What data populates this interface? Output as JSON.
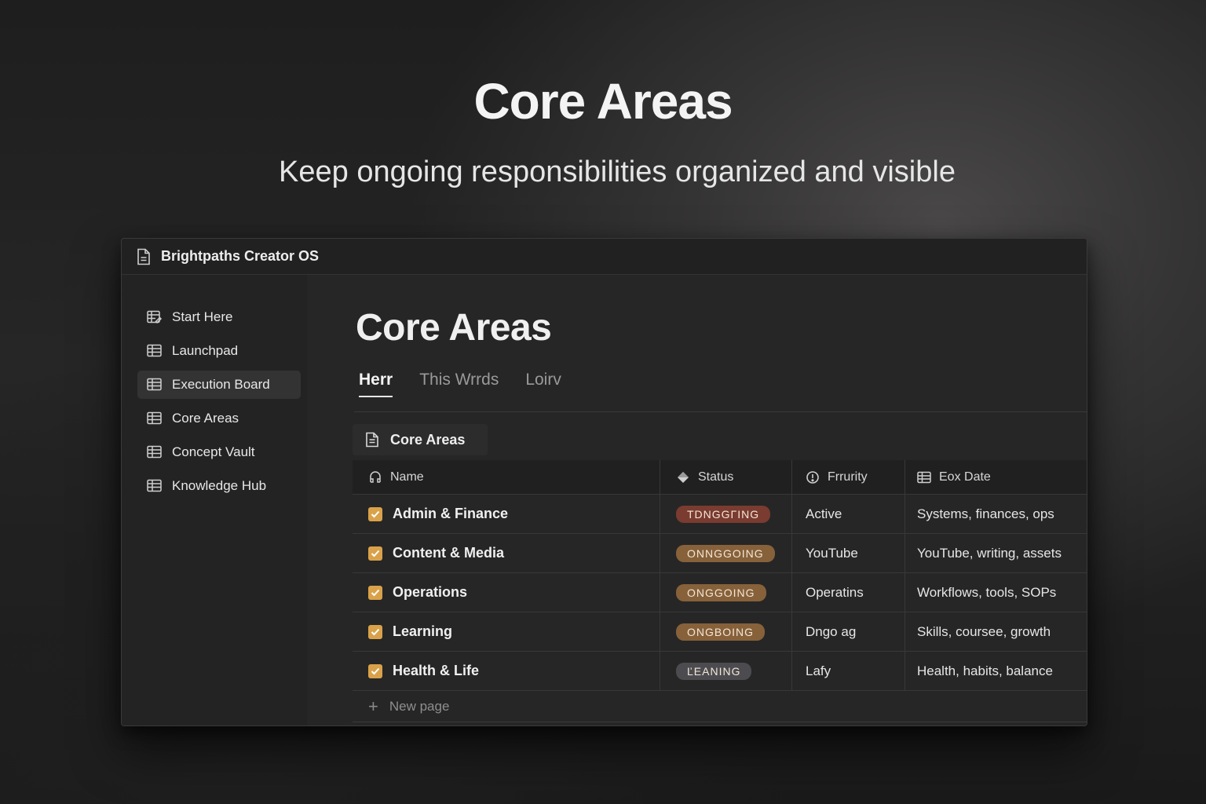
{
  "hero": {
    "title": "Core Areas",
    "subtitle": "Keep ongoing responsibilities organized and visible"
  },
  "window": {
    "title": "Brightpaths Creator OS",
    "title_icon": "document-icon"
  },
  "sidebar": {
    "items": [
      {
        "label": "Start Here",
        "icon": "table-edit-icon",
        "active": false
      },
      {
        "label": "Launchpad",
        "icon": "table-icon",
        "active": false
      },
      {
        "label": "Execution Board",
        "icon": "table-icon",
        "active": true
      },
      {
        "label": "Core Areas",
        "icon": "table-icon",
        "active": false
      },
      {
        "label": "Concept Vault",
        "icon": "table-icon",
        "active": false
      },
      {
        "label": "Knowledge Hub",
        "icon": "table-icon",
        "active": false
      }
    ]
  },
  "main": {
    "title": "Core Areas",
    "tabs": [
      {
        "label": "Herr",
        "active": true
      },
      {
        "label": "This Wrrds",
        "active": false
      },
      {
        "label": "Loirv",
        "active": false
      }
    ],
    "database": {
      "title": "Core Areas",
      "icon": "document-icon",
      "columns": {
        "name": "Name",
        "status": "Status",
        "priority": "Frrurity",
        "description": "Eox Date"
      },
      "rows": [
        {
          "name": "Admin & Finance",
          "checked": true,
          "status": "TDNGGΓING",
          "status_color": "#7a3b30",
          "priority": "Active",
          "description": "Systems, finances, ops"
        },
        {
          "name": "Content & Media",
          "checked": true,
          "status": "ONNGGOING",
          "status_color": "#86613a",
          "priority": "YouTube",
          "description": "YouTube, writing, assets"
        },
        {
          "name": "Operations",
          "checked": true,
          "status": "ONGGOING",
          "status_color": "#86613a",
          "priority": "Operatins",
          "description": "Workflows, tools, SOPs"
        },
        {
          "name": "Learning",
          "checked": true,
          "status": "ONGBOING",
          "status_color": "#86613a",
          "priority": "Dngo ag",
          "description": "Skills, coursee, growth"
        },
        {
          "name": "Health & Life",
          "checked": true,
          "status": "ĽEANING",
          "status_color": "#4c4c50",
          "priority": "Lafy",
          "description": "Health, habits, balance"
        }
      ],
      "new_page_label": "New page"
    }
  },
  "colors": {
    "checkbox": "#d9a24a",
    "background": "#262626"
  }
}
